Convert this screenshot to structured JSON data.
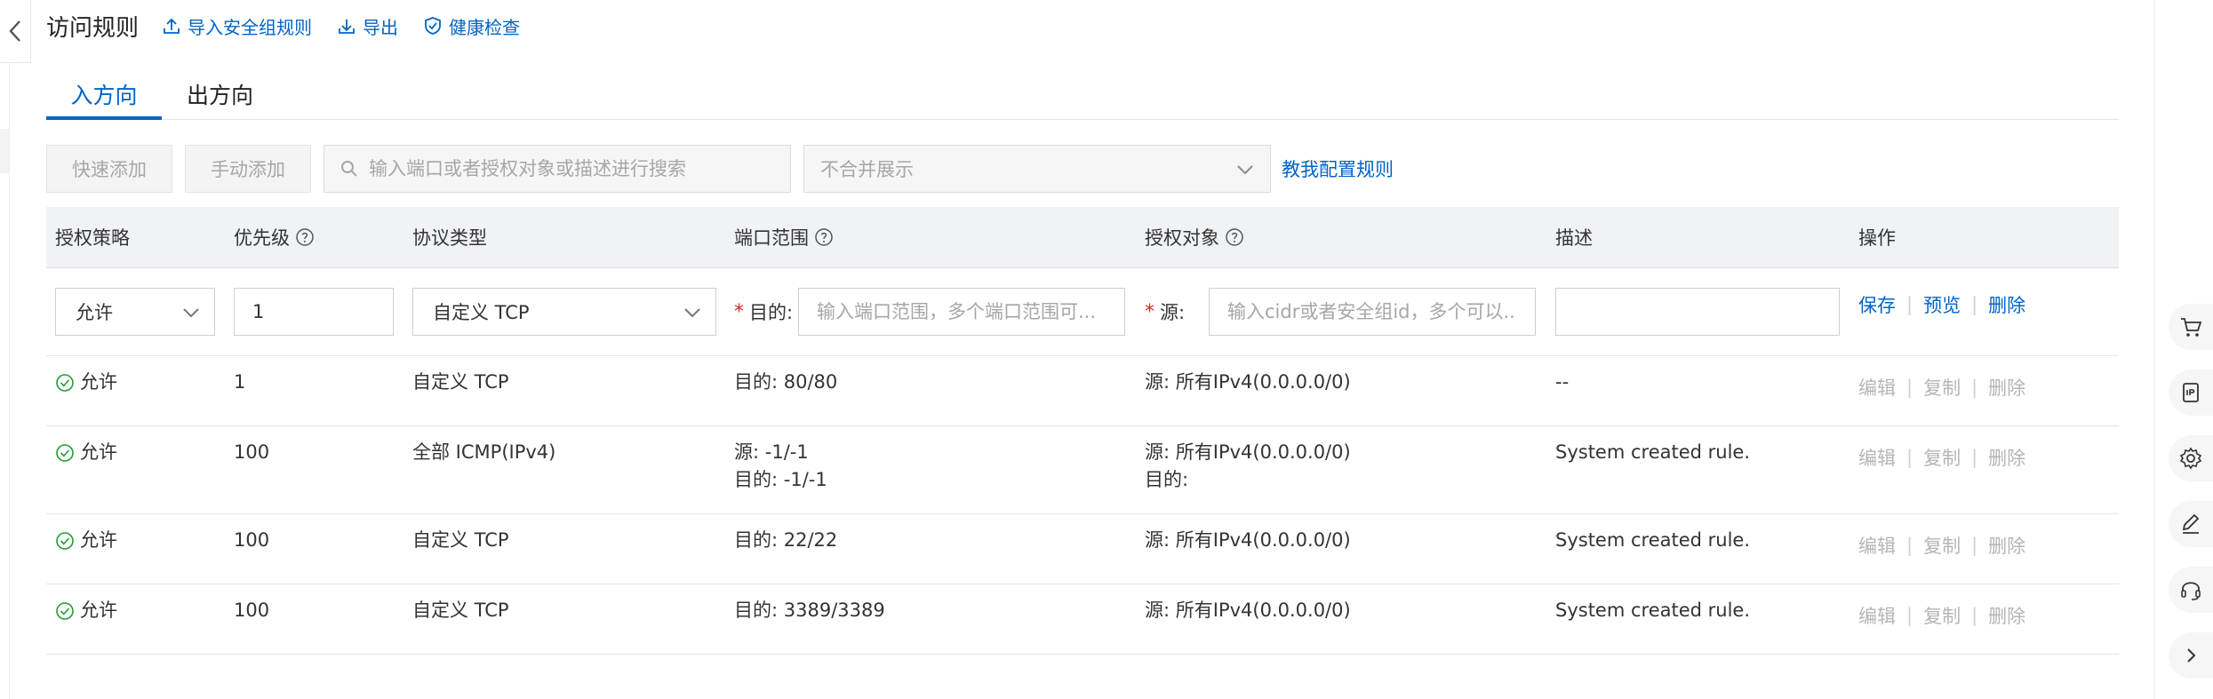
{
  "header": {
    "title": "访问规则",
    "import_label": "导入安全组规则",
    "export_label": "导出",
    "health_label": "健康检查"
  },
  "tabs": {
    "inbound": "入方向",
    "outbound": "出方向"
  },
  "toolbar": {
    "quick_add": "快速添加",
    "manual_add": "手动添加",
    "search_placeholder": "输入端口或者授权对象或描述进行搜索",
    "merge_value": "不合并展示",
    "teach_link": "教我配置规则"
  },
  "columns": {
    "policy": "授权策略",
    "priority": "优先级",
    "protocol": "协议类型",
    "port": "端口范围",
    "target": "授权对象",
    "desc": "描述",
    "ops": "操作"
  },
  "edit_row": {
    "policy": "允许",
    "priority": "1",
    "protocol": "自定义 TCP",
    "dest_label": "目的:",
    "port_placeholder": "输入端口范围，多个端口范围可...",
    "src_label": "源:",
    "target_placeholder": "输入cidr或者安全组id，多个可以...",
    "desc_value": "",
    "save": "保存",
    "preview": "预览",
    "delete": "删除"
  },
  "row_ops": {
    "edit": "编辑",
    "copy": "复制",
    "delete": "删除"
  },
  "rows": [
    {
      "policy": "允许",
      "priority": "1",
      "protocol": "自定义 TCP",
      "port_line1": "目的: 80/80",
      "port_line2": "",
      "target_line1": "源: 所有IPv4(0.0.0.0/0)",
      "target_line2": "",
      "desc": "--"
    },
    {
      "policy": "允许",
      "priority": "100",
      "protocol": "全部 ICMP(IPv4)",
      "port_line1": "源: -1/-1",
      "port_line2": "目的: -1/-1",
      "target_line1": "源: 所有IPv4(0.0.0.0/0)",
      "target_line2": "目的:",
      "desc": "System created rule."
    },
    {
      "policy": "允许",
      "priority": "100",
      "protocol": "自定义 TCP",
      "port_line1": "目的: 22/22",
      "port_line2": "",
      "target_line1": "源: 所有IPv4(0.0.0.0/0)",
      "target_line2": "",
      "desc": "System created rule."
    },
    {
      "policy": "允许",
      "priority": "100",
      "protocol": "自定义 TCP",
      "port_line1": "目的: 3389/3389",
      "port_line2": "",
      "target_line1": "源: 所有IPv4(0.0.0.0/0)",
      "target_line2": "",
      "desc": "System created rule."
    }
  ],
  "colors": {
    "link_blue": "#0064c8",
    "success_green": "#1ea032",
    "required_red": "#e02020",
    "header_bg": "#f0f2f5"
  }
}
